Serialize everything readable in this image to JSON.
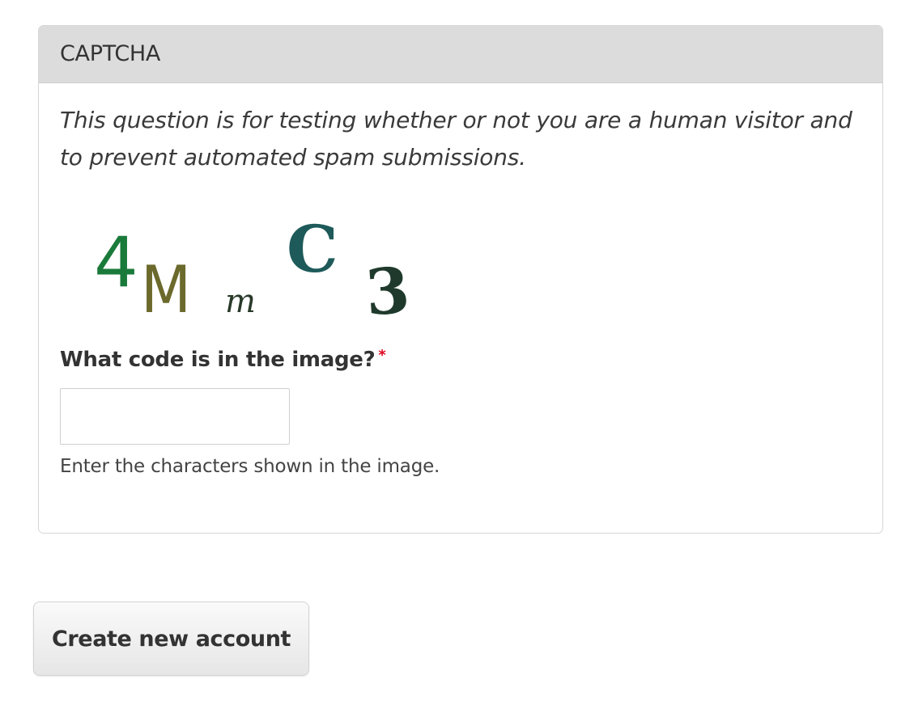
{
  "captcha": {
    "legend": "CAPTCHA",
    "description": "This question is for testing whether or not you are a human visitor and to prevent automated spam submissions.",
    "image_text": "4MmC3",
    "field_label": "What code is in the image?",
    "required_mark": "*",
    "input_value": "",
    "help_text": "Enter the characters shown in the image."
  },
  "actions": {
    "submit_label": "Create new account"
  },
  "colors": {
    "legend_bg": "#dcdcdc",
    "required": "#e0001b",
    "captcha_green": "#1a7a3a",
    "captcha_olive": "#6b6a2c",
    "captcha_teal": "#1e5a5a"
  }
}
